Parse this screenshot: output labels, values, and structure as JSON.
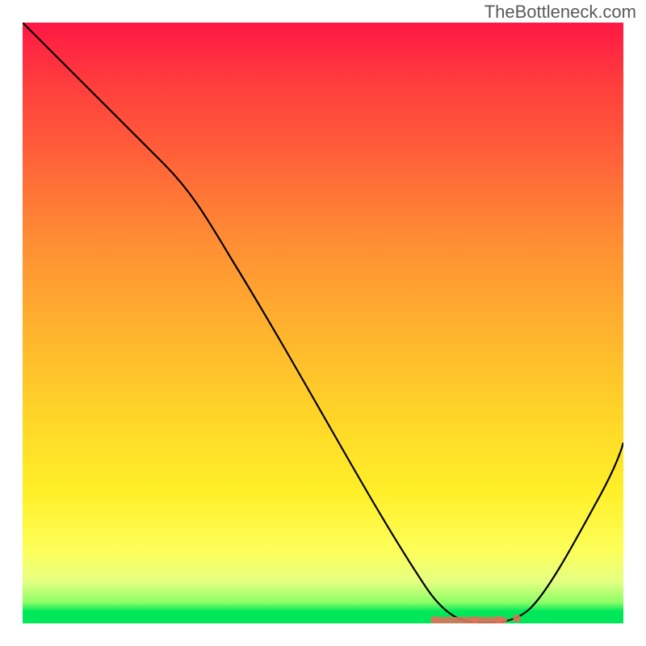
{
  "watermark": "TheBottleneck.com",
  "chart_data": {
    "type": "line",
    "title": "",
    "xlabel": "",
    "ylabel": "",
    "xlim": [
      0,
      100
    ],
    "ylim": [
      0,
      100
    ],
    "grid": false,
    "series": [
      {
        "name": "curve",
        "x": [
          0,
          5,
          10,
          15,
          20,
          25,
          30,
          35,
          40,
          45,
          50,
          55,
          60,
          65,
          67,
          70,
          73,
          76,
          78,
          80,
          83,
          86,
          90,
          95,
          100
        ],
        "y": [
          100,
          95,
          89,
          82,
          75,
          70,
          63,
          55,
          48,
          40,
          32,
          24,
          16,
          8,
          5,
          2,
          0.5,
          0,
          0,
          0.5,
          2,
          6,
          12,
          21,
          30
        ],
        "color": "#000000"
      }
    ],
    "annotation_region": {
      "description": "flat bottom highlight",
      "x_start": 69,
      "x_end": 80,
      "y": 0,
      "color": "#d9735a"
    },
    "background_gradient": {
      "top": "#ff1744",
      "mid": "#ffd428",
      "bottom": "#00e85a"
    }
  }
}
